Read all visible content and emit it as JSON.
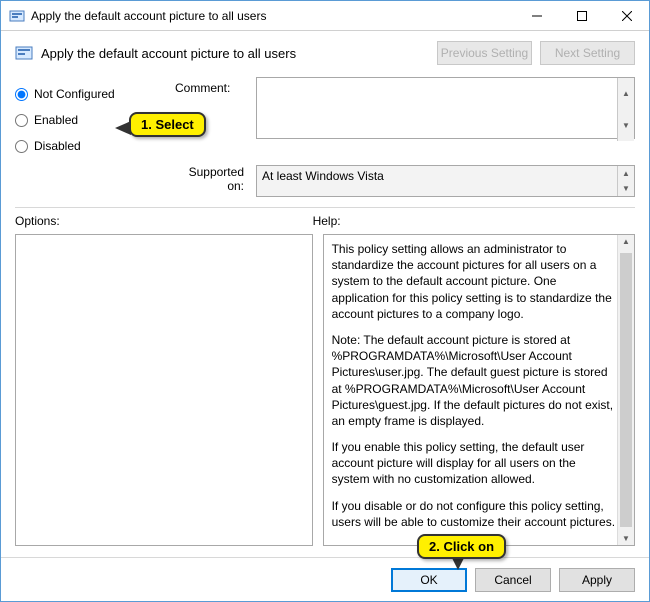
{
  "window": {
    "title": "Apply the default account picture to all users"
  },
  "header": {
    "policy_name": "Apply the default account picture to all users",
    "prev_btn": "Previous Setting",
    "next_btn": "Next Setting"
  },
  "radios": {
    "not_configured": "Not Configured",
    "enabled": "Enabled",
    "disabled": "Disabled",
    "selected": "not_configured"
  },
  "labels": {
    "comment": "Comment:",
    "supported": "Supported on:",
    "options": "Options:",
    "help": "Help:"
  },
  "comment_value": "",
  "supported_value": "At least Windows Vista",
  "help_paragraphs": [
    "This policy setting allows an administrator to standardize the account pictures for all users on a system to the default account picture. One application for this policy setting is to standardize the account pictures to a company logo.",
    "Note: The default account picture is stored at %PROGRAMDATA%\\Microsoft\\User Account Pictures\\user.jpg. The default guest picture is stored at %PROGRAMDATA%\\Microsoft\\User Account Pictures\\guest.jpg. If the default pictures do not exist, an empty frame is displayed.",
    "If you enable this policy setting, the default user account picture will display for all users on the system with no customization allowed.",
    "If you disable or do not configure this policy setting, users will be able to customize their account pictures."
  ],
  "footer": {
    "ok": "OK",
    "cancel": "Cancel",
    "apply": "Apply"
  },
  "callouts": {
    "c1": "1.  Select",
    "c2": "2.  Click on"
  }
}
